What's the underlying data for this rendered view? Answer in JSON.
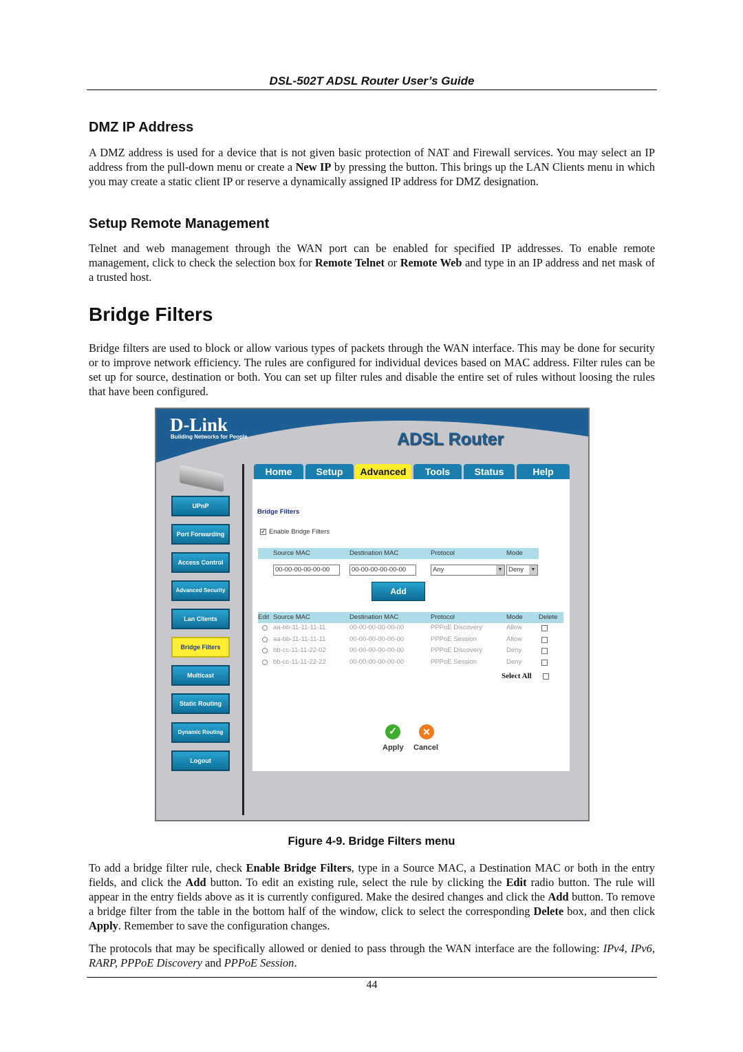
{
  "header": "DSL-502T ADSL Router User’s Guide",
  "sections": {
    "dmz_title": "DMZ IP Address",
    "dmz_text": [
      "A DMZ address is used for a device that is not given basic protection of NAT and Firewall services. You may select an IP address from the pull-down menu or create a ",
      "New IP",
      " by pressing the button. This brings up the LAN Clients menu in which you may create a static client IP or reserve a dynamically assigned IP address for DMZ designation."
    ],
    "remote_title": "Setup Remote Management",
    "remote_text": [
      "Telnet and web management through the WAN port can be enabled for specified IP addresses. To enable remote management, click to check the selection box for ",
      "Remote Telnet",
      " or ",
      "Remote Web",
      " and type in an IP address and net mask of a trusted host."
    ],
    "bridge_title": "Bridge Filters",
    "bridge_text": "Bridge filters are used to block or allow various types of packets through the WAN interface. This may be done for security or to improve network efficiency. The rules are configured for individual devices based on MAC address. Filter rules can be set up for source, destination or both. You can set up filter rules and disable the entire set of rules without loosing the rules that have been configured."
  },
  "figure": {
    "logo": "D-Link",
    "logo_sub": "Building Networks for People",
    "title": "ADSL Router",
    "tabs": [
      "Home",
      "Setup",
      "Advanced",
      "Tools",
      "Status",
      "Help"
    ],
    "active_tab": "Advanced",
    "sidebar": [
      "UPnP",
      "Port Forwarding",
      "Access Control",
      "Advanced Security",
      "Lan Clients",
      "Bridge Filters",
      "Multicast",
      "Static Routing",
      "Dynamic Routing",
      "Logout"
    ],
    "active_sidebar": "Bridge Filters",
    "panel_title": "Bridge Filters",
    "enable_label": "Enable Bridge Filters",
    "enable_checked": true,
    "entry_headers": [
      "Source MAC",
      "Destination MAC",
      "Protocol",
      "Mode"
    ],
    "source_mac": "00-00-00-00-00-00",
    "dest_mac": "00-00-00-00-00-00",
    "protocol": "Any",
    "mode": "Deny",
    "add_label": "Add",
    "table_headers": [
      "Edit",
      "Source MAC",
      "Destination MAC",
      "Protocol",
      "Mode",
      "Delete"
    ],
    "rows": [
      [
        "aa-bb-11-11-11-11",
        "00-00-00-00-00-00",
        "PPPoE Discovery",
        "Allow"
      ],
      [
        "aa-bb-11-11-11-11",
        "00-00-00-00-00-00",
        "PPPoE Session",
        "Allow"
      ],
      [
        "bb-cc-11-11-22-02",
        "00-00-00-00-00-00",
        "PPPoE Discovery",
        "Deny"
      ],
      [
        "bb-cc-11-11-22-22",
        "00-00-00-00-00-00",
        "PPPoE Session",
        "Deny"
      ]
    ],
    "select_all": "Select All",
    "apply": "Apply",
    "cancel": "Cancel"
  },
  "caption": "Figure 4-9. Bridge Filters menu",
  "after": {
    "p1": [
      "To add a bridge filter rule, check ",
      "Enable Bridge Filters",
      ", type in a Source MAC, a Destination MAC or both in the entry fields, and click the ",
      "Add",
      " button. To edit an existing rule, select the rule by clicking the ",
      "Edit",
      " radio button. The rule will appear in the entry fields above as it is currently configured. Make the desired changes and click the ",
      "Add",
      " button. To remove a bridge filter from the table in the bottom half of the window, click to select the corresponding ",
      "Delete",
      " box, and then click ",
      "Apply",
      ". Remember to save the configuration changes."
    ],
    "p2": [
      "The protocols that may be specifically allowed or denied to pass through the WAN interface are the following: ",
      "IPv4, IPv6, RARP, PPPoE Discovery",
      " and ",
      "PPPoE Session",
      "."
    ]
  },
  "page_number": "44"
}
